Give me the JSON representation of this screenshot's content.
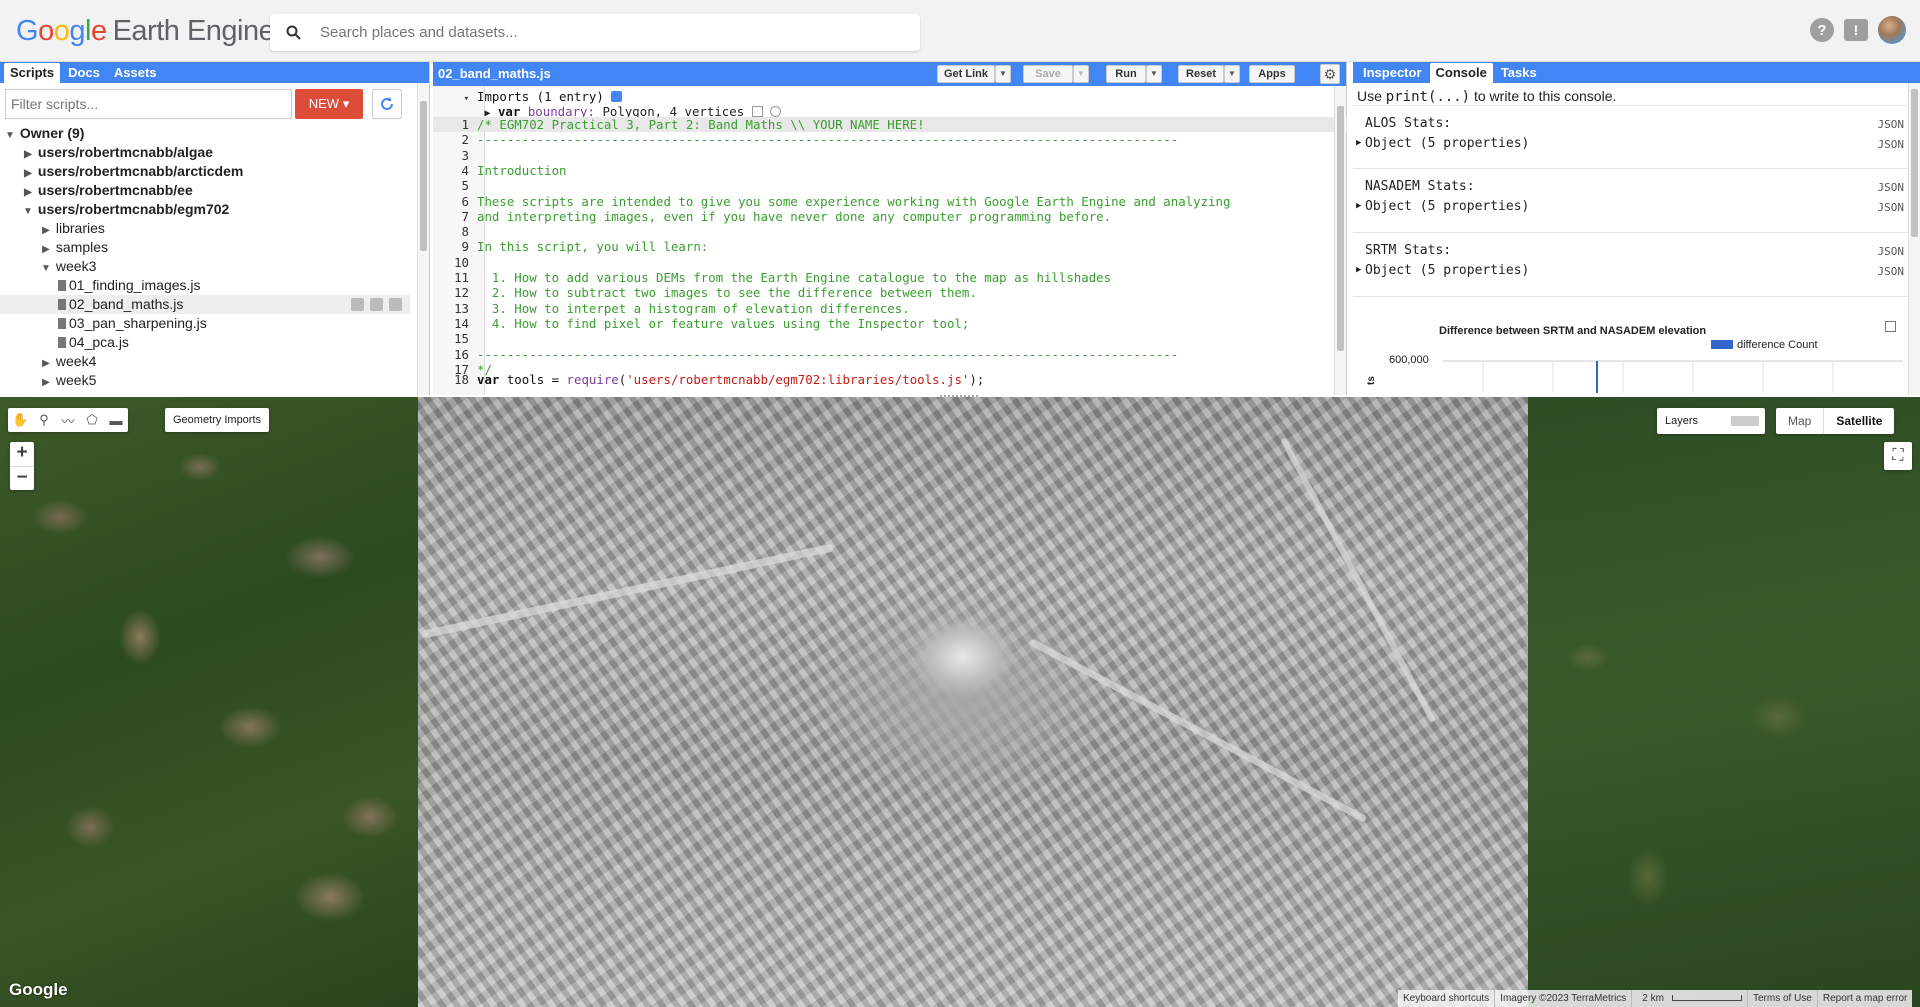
{
  "app": {
    "logo_google": "Google",
    "logo_product": "Earth Engine",
    "search_placeholder": "Search places and datasets...",
    "top_icons": [
      "help-icon",
      "feedback-icon",
      "account-avatar"
    ]
  },
  "left_panel": {
    "tabs": [
      "Scripts",
      "Docs",
      "Assets"
    ],
    "active_tab": "Scripts",
    "filter_placeholder": "Filter scripts...",
    "new_button": "NEW",
    "tree": [
      {
        "label": "Owner (9)",
        "level": 0,
        "expanded": true,
        "bold": true,
        "type": "folder"
      },
      {
        "label": "users/robertmcnabb/algae",
        "level": 1,
        "expanded": false,
        "bold": true,
        "type": "folder"
      },
      {
        "label": "users/robertmcnabb/arcticdem",
        "level": 1,
        "expanded": false,
        "bold": true,
        "type": "folder"
      },
      {
        "label": "users/robertmcnabb/ee",
        "level": 1,
        "expanded": false,
        "bold": true,
        "type": "folder"
      },
      {
        "label": "users/robertmcnabb/egm702",
        "level": 1,
        "expanded": true,
        "bold": true,
        "type": "folder"
      },
      {
        "label": "libraries",
        "level": 2,
        "expanded": false,
        "bold": false,
        "type": "folder"
      },
      {
        "label": "samples",
        "level": 2,
        "expanded": false,
        "bold": false,
        "type": "folder"
      },
      {
        "label": "week3",
        "level": 2,
        "expanded": true,
        "bold": false,
        "type": "folder"
      },
      {
        "label": "01_finding_images.js",
        "level": 3,
        "type": "file"
      },
      {
        "label": "02_band_maths.js",
        "level": 3,
        "type": "file",
        "selected": true
      },
      {
        "label": "03_pan_sharpening.js",
        "level": 3,
        "type": "file"
      },
      {
        "label": "04_pca.js",
        "level": 3,
        "type": "file"
      },
      {
        "label": "week4",
        "level": 2,
        "expanded": false,
        "bold": false,
        "type": "folder"
      },
      {
        "label": "week5",
        "level": 2,
        "expanded": false,
        "bold": false,
        "type": "folder"
      }
    ]
  },
  "editor": {
    "filename": "02_band_maths.js",
    "buttons": {
      "get_link": "Get Link",
      "save": "Save",
      "run": "Run",
      "reset": "Reset",
      "apps": "Apps"
    },
    "imports_header": "Imports (1 entry)",
    "import_keyword": "var",
    "import_name": "boundary:",
    "import_value": "Polygon, 4 vertices",
    "lines": [
      {
        "n": "1",
        "cls": "cm",
        "text": "/* EGM702 Practical 3, Part 2: Band Maths \\\\ YOUR NAME HERE!"
      },
      {
        "n": "2",
        "cls": "cm",
        "text": "----------------------------------------------------------------------------------------------"
      },
      {
        "n": "3",
        "cls": "cm",
        "text": ""
      },
      {
        "n": "4",
        "cls": "cm",
        "text": "Introduction"
      },
      {
        "n": "5",
        "cls": "cm",
        "text": ""
      },
      {
        "n": "6",
        "cls": "cm",
        "text": "These scripts are intended to give you some experience working with Google Earth Engine and analyzing"
      },
      {
        "n": "7",
        "cls": "cm",
        "text": "and interpreting images, even if you have never done any computer programming before."
      },
      {
        "n": "8",
        "cls": "cm",
        "text": ""
      },
      {
        "n": "9",
        "cls": "cm",
        "text": "In this script, you will learn:"
      },
      {
        "n": "10",
        "cls": "cm",
        "text": ""
      },
      {
        "n": "11",
        "cls": "cm",
        "text": "  1. How to add various DEMs from the Earth Engine catalogue to the map as hillshades"
      },
      {
        "n": "12",
        "cls": "cm",
        "text": "  2. How to subtract two images to see the difference between them."
      },
      {
        "n": "13",
        "cls": "cm",
        "text": "  3. How to interpet a histogram of elevation differences."
      },
      {
        "n": "14",
        "cls": "cm",
        "text": "  4. How to find pixel or feature values using the Inspector tool;"
      },
      {
        "n": "15",
        "cls": "cm",
        "text": ""
      },
      {
        "n": "16",
        "cls": "cm",
        "text": "----------------------------------------------------------------------------------------------"
      },
      {
        "n": "17",
        "cls": "cm",
        "text": "*/"
      }
    ],
    "line18": {
      "n": "18",
      "kw": "var",
      "name": " tools = ",
      "fn": "require",
      "open": "(",
      "str": "'users/robertmcnabb/egm702:libraries/tools.js'",
      "close": ");"
    }
  },
  "console": {
    "tabs": [
      "Inspector",
      "Console",
      "Tasks"
    ],
    "active_tab": "Console",
    "hint_prefix": "Use ",
    "hint_code": "print(...)",
    "hint_suffix": " to write to this console.",
    "stats": [
      {
        "title": "ALOS Stats:",
        "object": "Object (5 properties)",
        "json": "JSON"
      },
      {
        "title": "NASADEM Stats:",
        "object": "Object (5 properties)",
        "json": "JSON"
      },
      {
        "title": "SRTM Stats:",
        "object": "Object (5 properties)",
        "json": "JSON"
      }
    ]
  },
  "chart_data": {
    "type": "bar",
    "title": "Difference between SRTM and NASADEM elevation",
    "legend": [
      "difference Count"
    ],
    "legend_position": "top-right",
    "series_color": "#3366cc",
    "y_tick_labels": [
      "600,000"
    ],
    "ylabel_visible_fragment": "ts",
    "grid": true
  },
  "map": {
    "geometry_imports": "Geometry Imports",
    "zoom_in": "+",
    "zoom_out": "−",
    "layers_label": "Layers",
    "map_type_options": [
      "Map",
      "Satellite"
    ],
    "map_type_selected": "Satellite",
    "watermark": "Google",
    "attribution": {
      "shortcuts": "Keyboard shortcuts",
      "imagery": "Imagery ©2023 TerraMetrics",
      "scale": "2 km",
      "terms": "Terms of Use",
      "report": "Report a map error"
    }
  }
}
